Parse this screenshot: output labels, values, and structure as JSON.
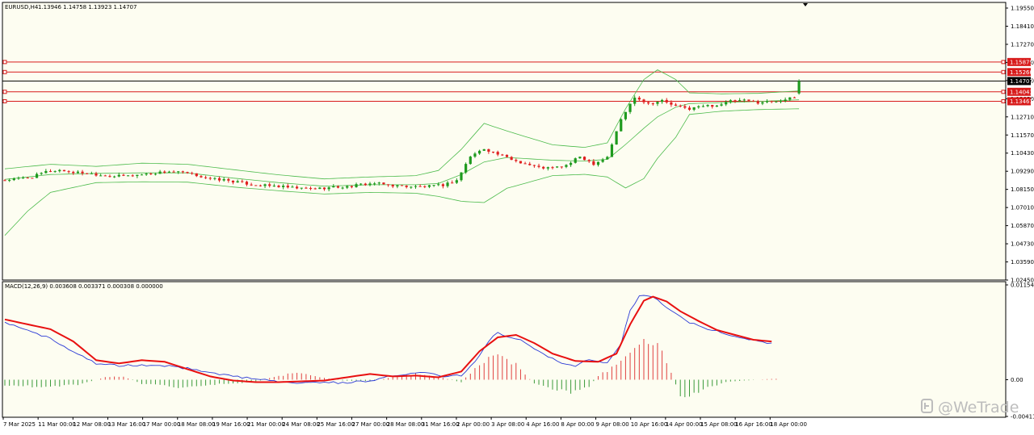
{
  "header": {
    "symbol": "EURUSD,H4",
    "ohlc": "1.13946 1.14758 1.13923 1.14707",
    "macd": "MACD(12,26,9) 0.003608 0.003371 0.000308 0.000000"
  },
  "watermark": "@WeTrade",
  "colors": {
    "background": "#fdfdf1",
    "candle_up": "#1e9a1e",
    "candle_down": "#e02020",
    "bands": "#4cbb4c",
    "level_lines": "#d81b1b",
    "current_price": "#000000",
    "macd_line": "#2b3ad6",
    "signal_line": "#e81010",
    "hist_pos": "#e04040",
    "hist_neg": "#3a9a3a"
  },
  "chart_data": [
    {
      "type": "candlestick",
      "title": "EURUSD,H4",
      "ylim": [
        1.0245,
        1.1955
      ],
      "y_ticks": [
        "1.19550",
        "1.18410",
        "1.17270",
        "1.16130",
        "1.14990",
        "1.13850",
        "1.12710",
        "1.11570",
        "1.10430",
        "1.09290",
        "1.08150",
        "1.07010",
        "1.05870",
        "1.04730",
        "1.03590",
        "1.02450"
      ],
      "close_path": [
        [
          0,
          1.086
        ],
        [
          3,
          1.087
        ],
        [
          6,
          1.088
        ],
        [
          9,
          1.0912
        ],
        [
          12,
          1.0922
        ],
        [
          15,
          1.0908
        ],
        [
          18,
          1.0905
        ],
        [
          21,
          1.0892
        ],
        [
          24,
          1.0885
        ],
        [
          27,
          1.0887
        ],
        [
          30,
          1.0896
        ],
        [
          33,
          1.0905
        ],
        [
          36,
          1.0914
        ],
        [
          39,
          1.0906
        ],
        [
          42,
          1.089
        ],
        [
          45,
          1.0868
        ],
        [
          48,
          1.0862
        ],
        [
          51,
          1.0848
        ],
        [
          54,
          1.0834
        ],
        [
          57,
          1.0827
        ],
        [
          60,
          1.0822
        ],
        [
          63,
          1.0812
        ],
        [
          66,
          1.0808
        ],
        [
          69,
          1.081
        ],
        [
          72,
          1.0817
        ],
        [
          75,
          1.0819
        ],
        [
          78,
          1.0833
        ],
        [
          81,
          1.0841
        ],
        [
          84,
          1.083
        ],
        [
          87,
          1.0824
        ],
        [
          90,
          1.082
        ],
        [
          93,
          1.0822
        ],
        [
          96,
          1.083
        ],
        [
          99,
          1.086
        ],
        [
          102,
          1.1007
        ],
        [
          105,
          1.1055
        ],
        [
          108,
          1.102
        ],
        [
          111,
          1.0988
        ],
        [
          114,
          1.0962
        ],
        [
          117,
          1.0938
        ],
        [
          120,
          1.0935
        ],
        [
          123,
          1.0951
        ],
        [
          126,
          1.1005
        ],
        [
          129,
          1.0962
        ],
        [
          132,
          1.1005
        ],
        [
          135,
          1.1235
        ],
        [
          138,
          1.1375
        ],
        [
          141,
          1.1332
        ],
        [
          144,
          1.135
        ],
        [
          147,
          1.1315
        ],
        [
          150,
          1.13
        ],
        [
          153,
          1.1317
        ],
        [
          156,
          1.1322
        ],
        [
          159,
          1.1346
        ],
        [
          162,
          1.135
        ],
        [
          165,
          1.134
        ],
        [
          168,
          1.1345
        ],
        [
          171,
          1.1358
        ],
        [
          174,
          1.1371
        ]
      ],
      "bands": {
        "upper": [
          [
            0,
            1.093
          ],
          [
            10,
            1.0958
          ],
          [
            20,
            1.0945
          ],
          [
            30,
            1.0965
          ],
          [
            40,
            1.0958
          ],
          [
            50,
            1.0925
          ],
          [
            60,
            1.0893
          ],
          [
            70,
            1.0868
          ],
          [
            80,
            1.088
          ],
          [
            90,
            1.0888
          ],
          [
            95,
            1.092
          ],
          [
            100,
            1.105
          ],
          [
            105,
            1.121
          ],
          [
            110,
            1.1163
          ],
          [
            120,
            1.1078
          ],
          [
            127,
            1.1062
          ],
          [
            132,
            1.109
          ],
          [
            136,
            1.13
          ],
          [
            140,
            1.148
          ],
          [
            143,
            1.154
          ],
          [
            147,
            1.148
          ],
          [
            150,
            1.1398
          ],
          [
            157,
            1.1392
          ],
          [
            165,
            1.1395
          ],
          [
            174,
            1.141
          ]
        ],
        "middle": [
          [
            0,
            1.0865
          ],
          [
            10,
            1.0895
          ],
          [
            20,
            1.0902
          ],
          [
            30,
            1.0905
          ],
          [
            40,
            1.0905
          ],
          [
            50,
            1.0873
          ],
          [
            60,
            1.0845
          ],
          [
            70,
            1.0823
          ],
          [
            80,
            1.0832
          ],
          [
            90,
            1.0832
          ],
          [
            95,
            1.084
          ],
          [
            100,
            1.0895
          ],
          [
            105,
            1.0972
          ],
          [
            110,
            1.1
          ],
          [
            120,
            1.0983
          ],
          [
            127,
            1.0978
          ],
          [
            132,
            1.0988
          ],
          [
            136,
            1.108
          ],
          [
            140,
            1.118
          ],
          [
            143,
            1.125
          ],
          [
            147,
            1.131
          ],
          [
            150,
            1.1332
          ],
          [
            157,
            1.1338
          ],
          [
            165,
            1.1345
          ],
          [
            174,
            1.1355
          ]
        ],
        "lower": [
          [
            0,
            1.052
          ],
          [
            5,
            1.067
          ],
          [
            10,
            1.0785
          ],
          [
            20,
            1.0845
          ],
          [
            30,
            1.085
          ],
          [
            40,
            1.0848
          ],
          [
            50,
            1.0818
          ],
          [
            60,
            1.0795
          ],
          [
            70,
            1.0775
          ],
          [
            80,
            1.0785
          ],
          [
            90,
            1.078
          ],
          [
            95,
            1.076
          ],
          [
            100,
            1.073
          ],
          [
            105,
            1.0722
          ],
          [
            110,
            1.081
          ],
          [
            120,
            1.0888
          ],
          [
            127,
            1.0896
          ],
          [
            132,
            1.088
          ],
          [
            136,
            1.0812
          ],
          [
            140,
            1.087
          ],
          [
            143,
            1.0995
          ],
          [
            147,
            1.1125
          ],
          [
            150,
            1.1265
          ],
          [
            157,
            1.1285
          ],
          [
            165,
            1.1295
          ],
          [
            174,
            1.13
          ]
        ]
      },
      "levels": [
        {
          "value": "1.15879",
          "color": "#d81b1b"
        },
        {
          "value": "1.15260",
          "color": "#d81b1b"
        },
        {
          "value": "1.14707",
          "color": "#000000"
        },
        {
          "value": "1.14043",
          "color": "#d81b1b"
        },
        {
          "value": "1.13461",
          "color": "#d81b1b"
        }
      ]
    },
    {
      "type": "macd",
      "title": "MACD(12,26,9)",
      "ylim": [
        -0.004115,
        0.011545
      ],
      "y_ticks": [
        "0.011545",
        "0.00",
        "-0.004115"
      ],
      "macd_line": [
        [
          0,
          0.007
        ],
        [
          5,
          0.0062
        ],
        [
          10,
          0.005
        ],
        [
          15,
          0.0035
        ],
        [
          20,
          0.002
        ],
        [
          25,
          0.0017
        ],
        [
          30,
          0.0018
        ],
        [
          35,
          0.0017
        ],
        [
          40,
          0.0014
        ],
        [
          45,
          0.0009
        ],
        [
          50,
          0.0004
        ],
        [
          55,
          0.0001
        ],
        [
          60,
          -0.0002
        ],
        [
          65,
          -0.0004
        ],
        [
          70,
          -0.0003
        ],
        [
          75,
          -0.0004
        ],
        [
          80,
          -0.0001
        ],
        [
          85,
          0.0005
        ],
        [
          90,
          0.0009
        ],
        [
          93,
          0.0008
        ],
        [
          96,
          0.0004
        ],
        [
          100,
          0.0005
        ],
        [
          103,
          0.0022
        ],
        [
          106,
          0.0048
        ],
        [
          108,
          0.0058
        ],
        [
          110,
          0.0053
        ],
        [
          113,
          0.005
        ],
        [
          117,
          0.0035
        ],
        [
          122,
          0.002
        ],
        [
          125,
          0.0016
        ],
        [
          128,
          0.0025
        ],
        [
          132,
          0.002
        ],
        [
          135,
          0.0045
        ],
        [
          137,
          0.0085
        ],
        [
          139,
          0.0102
        ],
        [
          141,
          0.0104
        ],
        [
          143,
          0.0098
        ],
        [
          146,
          0.0085
        ],
        [
          150,
          0.007
        ],
        [
          155,
          0.0061
        ],
        [
          160,
          0.0053
        ],
        [
          165,
          0.0047
        ],
        [
          168,
          0.0045
        ]
      ],
      "signal_line": [
        [
          0,
          0.0074
        ],
        [
          5,
          0.0068
        ],
        [
          10,
          0.0062
        ],
        [
          15,
          0.0047
        ],
        [
          20,
          0.0024
        ],
        [
          25,
          0.002
        ],
        [
          30,
          0.0024
        ],
        [
          35,
          0.0022
        ],
        [
          40,
          0.0013
        ],
        [
          45,
          0.0004
        ],
        [
          50,
          -0.0001
        ],
        [
          55,
          -0.0003
        ],
        [
          60,
          -0.0003
        ],
        [
          65,
          -0.0002
        ],
        [
          70,
          -0.0001
        ],
        [
          75,
          0.0003
        ],
        [
          80,
          0.0007
        ],
        [
          85,
          0.0004
        ],
        [
          90,
          0.0005
        ],
        [
          95,
          0.0003
        ],
        [
          100,
          0.001
        ],
        [
          104,
          0.0035
        ],
        [
          108,
          0.0052
        ],
        [
          112,
          0.0055
        ],
        [
          116,
          0.0045
        ],
        [
          120,
          0.0032
        ],
        [
          125,
          0.0023
        ],
        [
          130,
          0.0022
        ],
        [
          134,
          0.0032
        ],
        [
          137,
          0.0068
        ],
        [
          140,
          0.0097
        ],
        [
          142,
          0.0102
        ],
        [
          145,
          0.0096
        ],
        [
          148,
          0.0084
        ],
        [
          152,
          0.0072
        ],
        [
          156,
          0.0061
        ],
        [
          160,
          0.0055
        ],
        [
          164,
          0.0049
        ],
        [
          168,
          0.0047
        ]
      ],
      "histogram_profile": [
        [
          0,
          -0.0007
        ],
        [
          10,
          -0.0009
        ],
        [
          16,
          -0.0006
        ],
        [
          22,
          0.0003
        ],
        [
          26,
          0.0004
        ],
        [
          30,
          -0.0005
        ],
        [
          38,
          -0.0009
        ],
        [
          45,
          -0.0006
        ],
        [
          52,
          -0.0004
        ],
        [
          56,
          -0.0001
        ],
        [
          58,
          0.0002
        ],
        [
          64,
          0.0009
        ],
        [
          70,
          0.0002
        ],
        [
          74,
          -0.0001
        ],
        [
          80,
          -0.0002
        ],
        [
          85,
          0.0003
        ],
        [
          90,
          0.0007
        ],
        [
          96,
          0.0002
        ],
        [
          100,
          -0.0003
        ],
        [
          104,
          0.002
        ],
        [
          108,
          0.0029
        ],
        [
          112,
          0.0018
        ],
        [
          116,
          -0.0005
        ],
        [
          120,
          -0.0012
        ],
        [
          124,
          -0.0015
        ],
        [
          128,
          -0.0008
        ],
        [
          130,
          0.0005
        ],
        [
          134,
          0.0017
        ],
        [
          138,
          0.0039
        ],
        [
          141,
          0.0048
        ],
        [
          144,
          0.0038
        ],
        [
          146,
          0.0008
        ],
        [
          148,
          -0.0019
        ],
        [
          151,
          -0.0018
        ],
        [
          154,
          -0.001
        ],
        [
          158,
          -0.0003
        ],
        [
          162,
          -0.0001
        ],
        [
          168,
          0.0001
        ]
      ]
    }
  ],
  "x_axis": {
    "labels": [
      "7 Mar 2025",
      "11 Mar 00:00",
      "12 Mar 08:00",
      "13 Mar 16:00",
      "17 Mar 00:00",
      "18 Mar 08:00",
      "19 Mar 16:00",
      "21 Mar 00:00",
      "24 Mar 08:00",
      "25 Mar 16:00",
      "27 Mar 00:00",
      "28 Mar 08:00",
      "31 Mar 16:00",
      "2 Apr 00:00",
      "3 Apr 08:00",
      "4 Apr 16:00",
      "8 Apr 00:00",
      "9 Apr 08:00",
      "10 Apr 16:00",
      "14 Apr 00:00",
      "15 Apr 08:00",
      "16 Apr 16:00",
      "18 Apr 00:00"
    ]
  }
}
